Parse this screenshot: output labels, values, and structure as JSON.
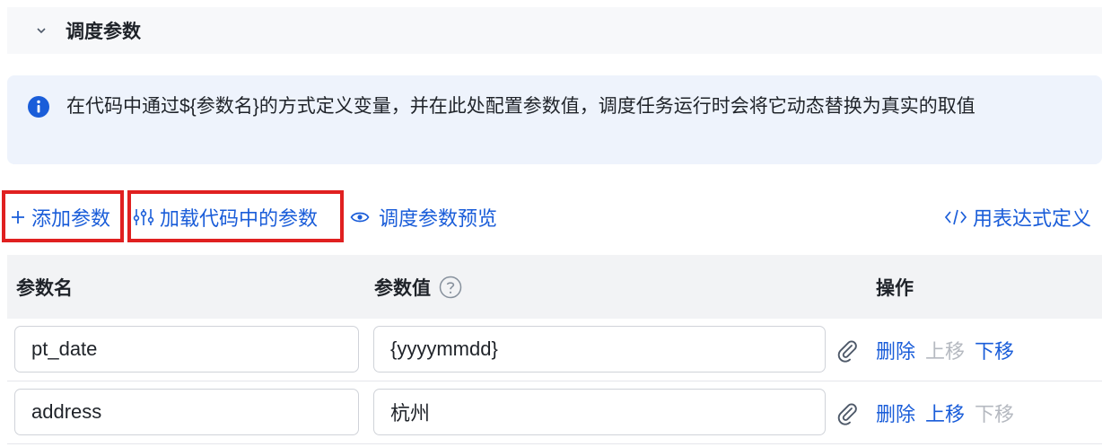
{
  "section": {
    "title": "调度参数",
    "collapse_icon": "chevron-down-icon"
  },
  "info": {
    "icon": "info-icon",
    "text": "在代码中通过${参数名}的方式定义变量，并在此处配置参数值，调度任务运行时会将它动态替换为真实的取值"
  },
  "toolbar": {
    "add_param": "添加参数",
    "load_params": "加载代码中的参数",
    "preview": "调度参数预览",
    "expression": "用表达式定义"
  },
  "table": {
    "headers": {
      "name": "参数名",
      "value": "参数值",
      "actions": "操作"
    },
    "rows": [
      {
        "name": "pt_date",
        "value": "{yyyymmdd}",
        "delete": "删除",
        "move_up": "上移",
        "move_down": "下移",
        "up_enabled": false,
        "down_enabled": true
      },
      {
        "name": "address",
        "value": "杭州",
        "delete": "删除",
        "move_up": "上移",
        "move_down": "下移",
        "up_enabled": true,
        "down_enabled": false
      }
    ]
  },
  "colors": {
    "link": "#1a5dd9",
    "disabled": "#b5b9c0",
    "highlight": "#e02020",
    "info_bg": "#eef3fc",
    "header_bg": "#f2f3f5"
  }
}
